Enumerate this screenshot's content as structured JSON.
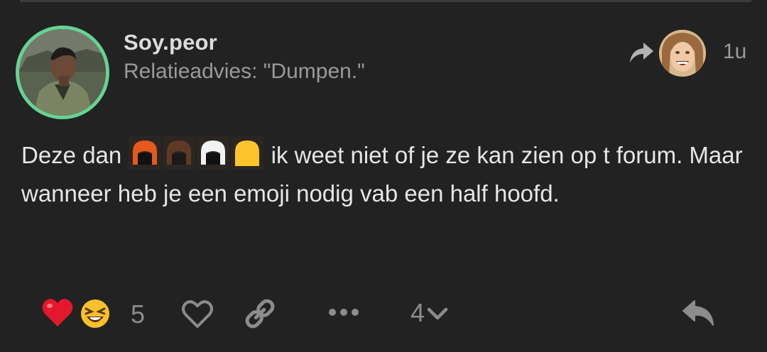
{
  "post": {
    "username": "Soy.peor",
    "topic_title": "Relatieadvies: \"Dumpen.\"",
    "time_ago": "1u",
    "body": {
      "before_emoji": "Deze dan ",
      "emojis": [
        "orange-hair-emoji",
        "brown-hair-emoji",
        "white-hair-emoji",
        "bald-yellow-emoji"
      ],
      "after_emoji": " ik weet niet of je ze kan zien op t forum. Maar wanneer heb je een emoji nodig vab een half hoofd."
    }
  },
  "actions": {
    "reactions": [
      "heart-emoji",
      "laughing-emoji"
    ],
    "reaction_count": "5",
    "reply_count": "4"
  },
  "colors": {
    "background": "#222222",
    "avatar_ring": "#66d395",
    "text_primary": "#e6e6e6",
    "text_muted": "#9a9a9a",
    "icon_muted": "#8c8c8c"
  }
}
